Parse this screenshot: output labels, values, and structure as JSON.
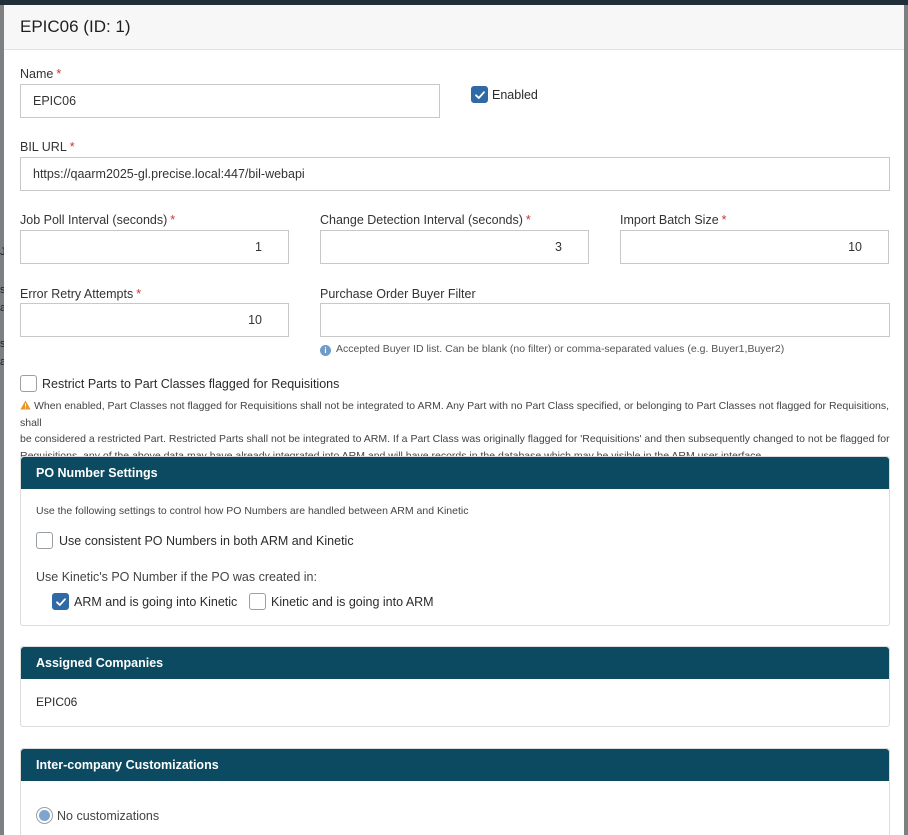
{
  "modal": {
    "title": "EPIC06 (ID: 1)"
  },
  "form": {
    "name": {
      "label": "Name",
      "value": "EPIC06"
    },
    "enabled": {
      "label": "Enabled",
      "checked": true
    },
    "bil_url": {
      "label": "BIL URL",
      "value": "https://qaarm2025-gl.precise.local:447/bil-webapi"
    },
    "job_poll_interval": {
      "label": "Job Poll Interval (seconds)",
      "value": "1"
    },
    "change_detection_interval": {
      "label": "Change Detection Interval (seconds)",
      "value": "3"
    },
    "import_batch_size": {
      "label": "Import Batch Size",
      "value": "10"
    },
    "error_retry_attempts": {
      "label": "Error Retry Attempts",
      "value": "10"
    },
    "po_buyer_filter": {
      "label": "Purchase Order Buyer Filter",
      "value": "",
      "help": "Accepted Buyer ID list. Can be blank (no filter) or comma-separated values (e.g. Buyer1,Buyer2)"
    },
    "restrict_parts": {
      "label": "Restrict Parts to Part Classes flagged for Requisitions",
      "checked": false,
      "warning_lines": [
        "When enabled, Part Classes not flagged for Requisitions shall not be integrated to ARM. Any Part with no Part Class specified, or belonging to Part Classes not flagged for Requisitions, shall",
        "be considered a restricted Part. Restricted Parts shall not be integrated to ARM. If a Part Class was originally flagged for 'Requisitions' and then subsequently changed to not be flagged for",
        "Requisitions, any of the above data may have already integrated into ARM and will have records in the database which may be visible in the ARM user interface"
      ]
    }
  },
  "po_settings": {
    "title": "PO Number Settings",
    "description": "Use the following settings to control how PO Numbers are handled between ARM and Kinetic",
    "consistent": {
      "label": "Use consistent PO Numbers in both ARM and Kinetic",
      "checked": false
    },
    "kinetic_label": "Use Kinetic's PO Number if the PO was created in:",
    "arm_to_kinetic": {
      "label": "ARM and is going into Kinetic",
      "checked": true
    },
    "kinetic_to_arm": {
      "label": "Kinetic and is going into ARM",
      "checked": false
    }
  },
  "assigned_companies": {
    "title": "Assigned Companies",
    "items": [
      "EPIC06"
    ]
  },
  "intercompany": {
    "title": "Inter-company Customizations",
    "option": {
      "label": "No customizations",
      "selected": true
    }
  },
  "colors": {
    "panel_header": "#0b4a61",
    "checkbox_checked": "#2f6aa6",
    "required": "#d0342c",
    "warning": "#e8962a"
  },
  "background_glyphs": [
    "J",
    "s",
    "a",
    "s",
    "a"
  ]
}
